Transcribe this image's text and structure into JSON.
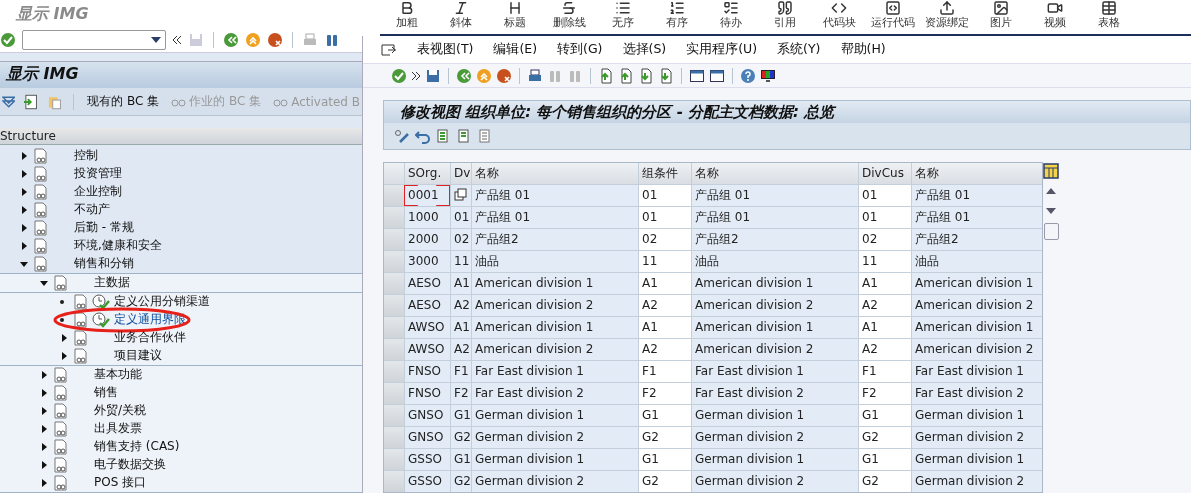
{
  "editor_toolbar": [
    {
      "kind": "bold",
      "label": "加粗"
    },
    {
      "kind": "italic",
      "label": "斜体"
    },
    {
      "kind": "heading",
      "label": "标题"
    },
    {
      "kind": "strike",
      "label": "删除线"
    },
    {
      "kind": "list",
      "label": "无序"
    },
    {
      "kind": "ordered",
      "label": "有序"
    },
    {
      "kind": "todo",
      "label": "待办"
    },
    {
      "kind": "quote",
      "label": "引用"
    },
    {
      "kind": "code",
      "label": "代码块"
    },
    {
      "kind": "run",
      "label": "运行代码"
    },
    {
      "kind": "upload",
      "label": "资源绑定"
    },
    {
      "kind": "image",
      "label": "图片"
    },
    {
      "kind": "video",
      "label": "视频"
    },
    {
      "kind": "table",
      "label": "表格"
    }
  ],
  "img_window": {
    "caption": "显示 IMG",
    "title": "显示 IMG",
    "toolbar": [
      {
        "label": "现有的 BC 集",
        "disabled": false
      },
      {
        "label": "作业的 BC 集",
        "disabled": true
      },
      {
        "label": "Activated B",
        "disabled": true
      }
    ],
    "structure_header": "Structure",
    "tree": [
      {
        "kind": "folder",
        "label": "控制",
        "expanded": false,
        "selected": false,
        "circled": false
      },
      {
        "kind": "folder",
        "label": "投资管理",
        "expanded": false,
        "selected": false,
        "circled": false
      },
      {
        "kind": "folder",
        "label": "企业控制",
        "expanded": false,
        "selected": false,
        "circled": false
      },
      {
        "kind": "folder",
        "label": "不动产",
        "expanded": false,
        "selected": false,
        "circled": false
      },
      {
        "kind": "folder",
        "label": "后勤 - 常规",
        "expanded": false,
        "selected": false,
        "circled": false
      },
      {
        "kind": "folder",
        "label": "环境,健康和安全",
        "expanded": false,
        "selected": false,
        "circled": false
      },
      {
        "kind": "folder",
        "label": "销售和分销",
        "expanded": true,
        "selected": false,
        "circled": false,
        "children": [
          {
            "kind": "folder",
            "label": "主数据",
            "expanded": true,
            "selected": false,
            "circled": false,
            "children": [
              {
                "kind": "activity",
                "label": "定义公用分销渠道",
                "selected": false,
                "circled": false
              },
              {
                "kind": "activity",
                "label": "定义通用界限",
                "selected": true,
                "circled": true
              },
              {
                "kind": "folder",
                "label": "业务合作伙伴",
                "expanded": false,
                "selected": false,
                "circled": false
              },
              {
                "kind": "folder",
                "label": "项目建议",
                "expanded": false,
                "selected": false,
                "circled": false
              }
            ]
          },
          {
            "kind": "folder",
            "label": "基本功能",
            "expanded": false,
            "selected": false,
            "circled": false
          },
          {
            "kind": "folder",
            "label": "销售",
            "expanded": false,
            "selected": false,
            "circled": false
          },
          {
            "kind": "folder",
            "label": "外贸/关税",
            "expanded": false,
            "selected": false,
            "circled": false
          },
          {
            "kind": "folder",
            "label": "出具发票",
            "expanded": false,
            "selected": false,
            "circled": false
          },
          {
            "kind": "folder",
            "label": "销售支持 (CAS)",
            "expanded": false,
            "selected": false,
            "circled": false
          },
          {
            "kind": "folder",
            "label": "电子数据交换",
            "expanded": false,
            "selected": false,
            "circled": false
          },
          {
            "kind": "folder",
            "label": "POS 接口",
            "expanded": false,
            "selected": false,
            "circled": false
          }
        ]
      }
    ]
  },
  "view_window": {
    "menu": [
      "表视图(T)",
      "编辑(E)",
      "转到(G)",
      "选择(S)",
      "实用程序(U)",
      "系统(Y)",
      "帮助(H)"
    ],
    "title": "修改视图 组织单位: 每个销售组织的分区 - 分配主文档数据: 总览",
    "table": {
      "columns": [
        {
          "label": "SOrg.",
          "editable": false
        },
        {
          "label": "Dv",
          "editable": false
        },
        {
          "label": "名称",
          "editable": false
        },
        {
          "label": "组条件",
          "editable": true
        },
        {
          "label": "名称",
          "editable": false
        },
        {
          "label": "DivCus",
          "editable": true
        },
        {
          "label": "名称",
          "editable": false
        }
      ],
      "rows": [
        {
          "focused": true,
          "sorg": "0001",
          "name1": "产品组 01",
          "group": "01",
          "name2": "产品组 01",
          "divcus": "01",
          "name3": "产品组 01"
        },
        {
          "focused": false,
          "sorg": "1000",
          "dv": "01",
          "name1": "产品组 01",
          "group": "01",
          "name2": "产品组 01",
          "divcus": "01",
          "name3": "产品组 01"
        },
        {
          "focused": false,
          "sorg": "2000",
          "dv": "02",
          "name1": "产品组2",
          "group": "02",
          "name2": "产品组2",
          "divcus": "02",
          "name3": "产品组2"
        },
        {
          "focused": false,
          "sorg": "3000",
          "dv": "11",
          "name1": "油品",
          "group": "11",
          "name2": "油品",
          "divcus": "11",
          "name3": "油品"
        },
        {
          "focused": false,
          "sorg": "AESO",
          "dv": "A1",
          "name1": "American division 1",
          "group": "A1",
          "name2": "American division 1",
          "divcus": "A1",
          "name3": "American division 1"
        },
        {
          "focused": false,
          "sorg": "AESO",
          "dv": "A2",
          "name1": "American division 2",
          "group": "A2",
          "name2": "American division 2",
          "divcus": "A2",
          "name3": "American division 2"
        },
        {
          "focused": false,
          "sorg": "AWSO",
          "dv": "A1",
          "name1": "American division 1",
          "group": "A1",
          "name2": "American division 1",
          "divcus": "A1",
          "name3": "American division 1"
        },
        {
          "focused": false,
          "sorg": "AWSO",
          "dv": "A2",
          "name1": "American division 2",
          "group": "A2",
          "name2": "American division 2",
          "divcus": "A2",
          "name3": "American division 2"
        },
        {
          "focused": false,
          "sorg": "FNSO",
          "dv": "F1",
          "name1": "Far East division 1",
          "group": "F1",
          "name2": "Far East division 1",
          "divcus": "F1",
          "name3": "Far East division 1"
        },
        {
          "focused": false,
          "sorg": "FNSO",
          "dv": "F2",
          "name1": "Far East division 2",
          "group": "F2",
          "name2": "Far East division 2",
          "divcus": "F2",
          "name3": "Far East division 2"
        },
        {
          "focused": false,
          "sorg": "GNSO",
          "dv": "G1",
          "name1": "German division 1",
          "group": "G1",
          "name2": "German division 1",
          "divcus": "G1",
          "name3": "German division 1"
        },
        {
          "focused": false,
          "sorg": "GNSO",
          "dv": "G2",
          "name1": "German division 2",
          "group": "G2",
          "name2": "German division 2",
          "divcus": "G2",
          "name3": "German division 2"
        },
        {
          "focused": false,
          "sorg": "GSSO",
          "dv": "G1",
          "name1": "German division 1",
          "group": "G1",
          "name2": "German division 1",
          "divcus": "G1",
          "name3": "German division 1"
        },
        {
          "focused": false,
          "sorg": "GSSO",
          "dv": "G2",
          "name1": "German division 2",
          "group": "G2",
          "name2": "German division 2",
          "divcus": "G2",
          "name3": "German division 2"
        }
      ]
    }
  }
}
